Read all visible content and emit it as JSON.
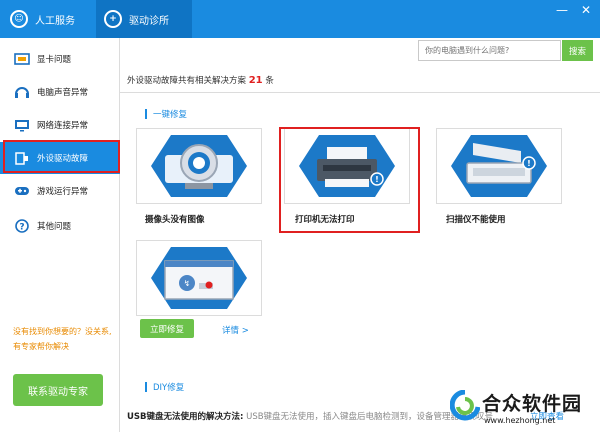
{
  "titlebar": {
    "tabs": [
      {
        "label": "人工服务",
        "icon": "support-icon"
      },
      {
        "label": "驱动诊所",
        "icon": "clinic-icon"
      }
    ],
    "window_buttons": [
      "minimize",
      "close"
    ]
  },
  "sidebar": {
    "items": [
      {
        "label": "显卡问题",
        "icon": "gpu-icon"
      },
      {
        "label": "电脑声音异常",
        "icon": "sound-icon"
      },
      {
        "label": "网络连接异常",
        "icon": "monitor-network-icon"
      },
      {
        "label": "外设驱动故障",
        "icon": "peripheral-icon",
        "active": true
      },
      {
        "label": "游戏运行异常",
        "icon": "gamepad-icon"
      },
      {
        "label": "其他问题",
        "icon": "question-icon"
      }
    ],
    "help_text": "没有找到你想要的？没关系,有专家帮你解决",
    "expert_button": "联系驱动专家"
  },
  "search": {
    "placeholder": "你的电脑遇到什么问题?",
    "button": "搜索"
  },
  "summary": {
    "prefix": "外设驱动故障共有相关解决方案",
    "count": "21",
    "suffix": "条"
  },
  "one_click": {
    "title": "一键修复",
    "cards": [
      {
        "label": "摄像头没有图像",
        "icon": "webcam-icon"
      },
      {
        "label": "打印机无法打印",
        "icon": "printer-icon"
      },
      {
        "label": "扫描仪不能使用",
        "icon": "scanner-icon"
      },
      {
        "label": "",
        "icon": "usb-window-icon"
      }
    ],
    "fix_button": "立即修复",
    "details_link": "详情 >"
  },
  "diy": {
    "title": "DIY修复",
    "usb_title": "USB键盘无法使用的解决方法:",
    "usb_desc": "USB键盘无法使用，插入键盘后电脑检测到，设备管理器出现叹号",
    "usb_link": "立即查看"
  },
  "watermark": {
    "title": "合众软件园",
    "url": "www.hezhong.net"
  },
  "colors": {
    "primary": "#1a8be0",
    "green": "#6cc24a",
    "red": "#e02020"
  }
}
